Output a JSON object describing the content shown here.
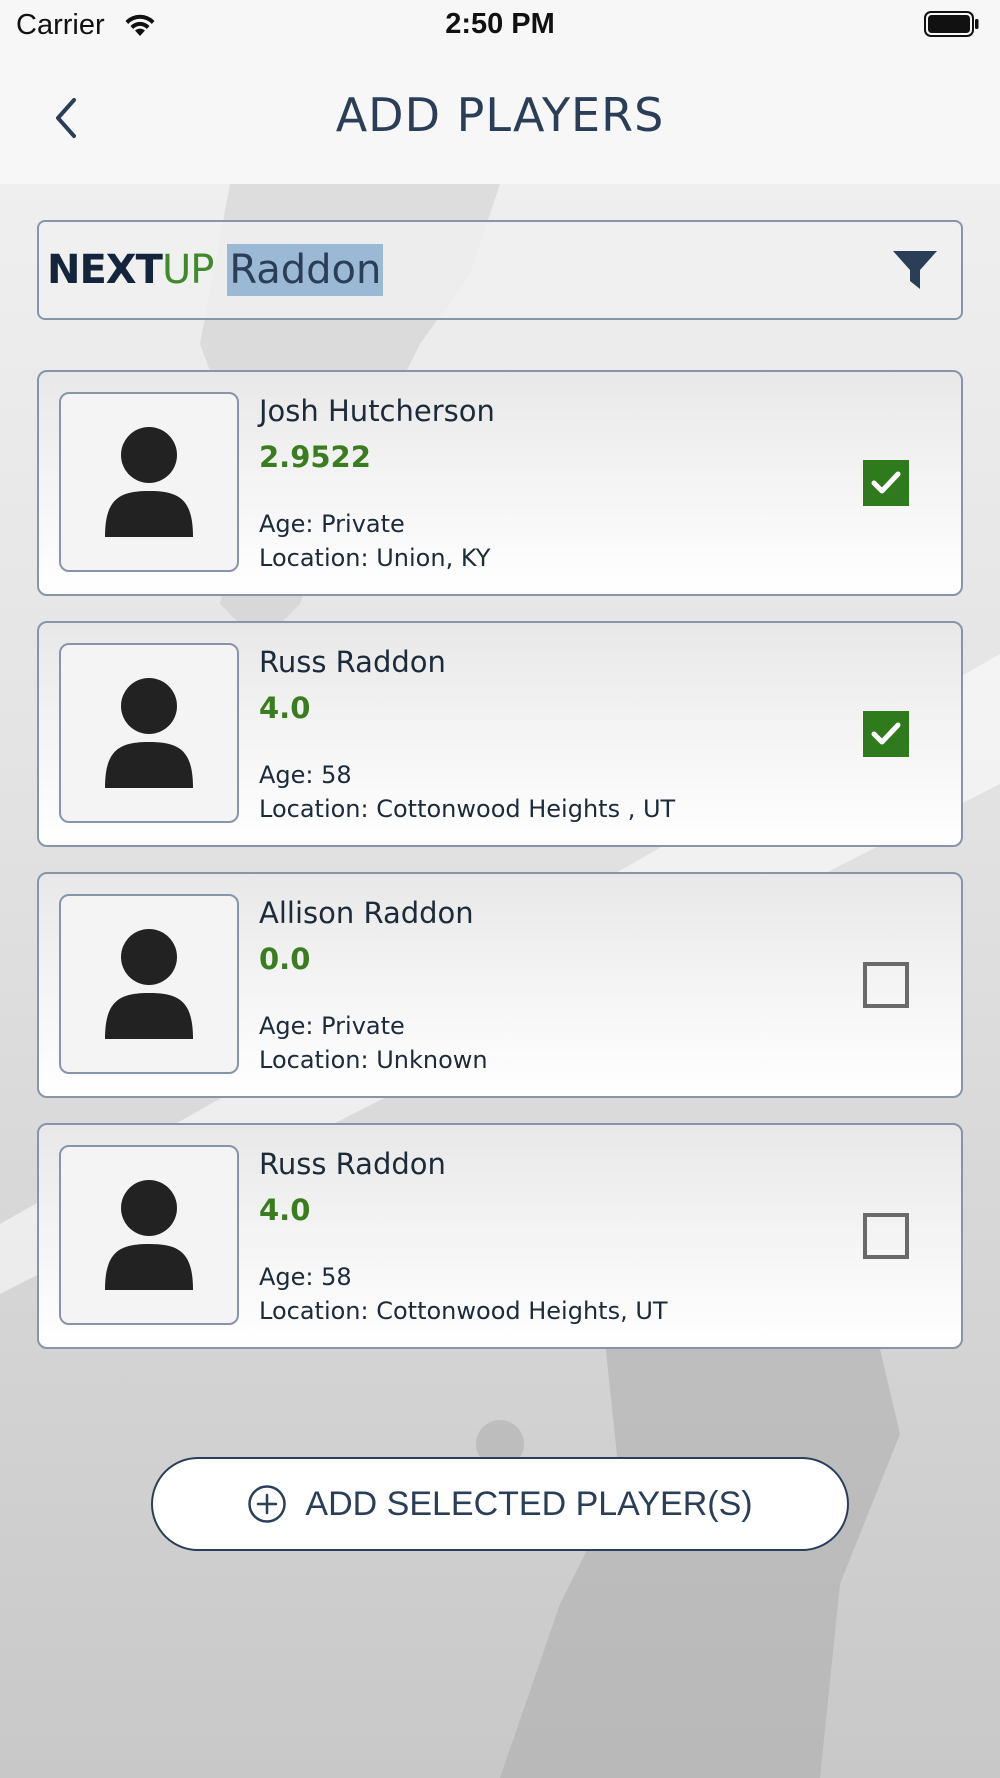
{
  "status_bar": {
    "carrier": "Carrier",
    "time": "2:50 PM"
  },
  "header": {
    "title": "ADD PLAYERS"
  },
  "search": {
    "brand_next": "NEXT",
    "brand_up": "UP",
    "query": "Raddon"
  },
  "players": [
    {
      "name": "Josh Hutcherson",
      "rating": "2.9522",
      "age": "Age: Private",
      "location": "Location: Union, KY",
      "selected": true
    },
    {
      "name": "Russ Raddon",
      "rating": "4.0",
      "age": "Age: 58",
      "location": "Location: Cottonwood Heights , UT",
      "selected": true
    },
    {
      "name": "Allison Raddon",
      "rating": "0.0",
      "age": "Age: Private",
      "location": "Location: Unknown",
      "selected": false
    },
    {
      "name": "Russ Raddon",
      "rating": "4.0",
      "age": "Age: 58",
      "location": "Location: Cottonwood Heights, UT",
      "selected": false
    }
  ],
  "footer": {
    "add_selected_label": "ADD SELECTED PLAYER(S)"
  },
  "colors": {
    "accent_navy": "#2b3e57",
    "rating_green": "#3a7d20",
    "checkbox_green": "#2f7a1d",
    "search_highlight": "#9bb8d4"
  },
  "icons": {
    "back": "chevron-left-icon",
    "filter": "funnel-icon",
    "avatar": "person-silhouette-icon",
    "check": "checkmark-icon",
    "add": "plus-circle-icon"
  }
}
